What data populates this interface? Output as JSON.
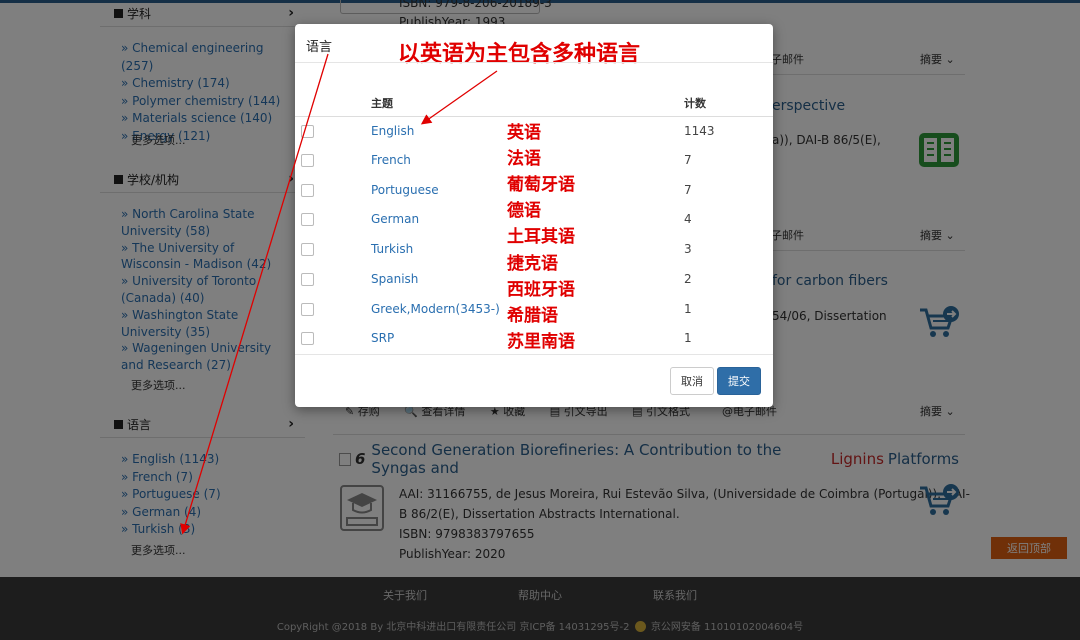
{
  "sidebar": {
    "subject": {
      "title": "学科",
      "items": [
        {
          "label": "» Chemical engineering",
          "count": "(257)"
        },
        {
          "label": "» Chemistry",
          "count": "(174)"
        },
        {
          "label": "» Polymer chemistry",
          "count": "(144)"
        },
        {
          "label": "» Materials science",
          "count": "(140)"
        },
        {
          "label": "» Energy",
          "count": "(121)"
        }
      ],
      "more": "更多选项..."
    },
    "school": {
      "title": "学校/机构",
      "items": [
        {
          "label": "» North Carolina State University",
          "count": "(58)"
        },
        {
          "label": "» The University of Wisconsin - Madison",
          "count": "(42)"
        },
        {
          "label": "» University of Toronto (Canada)",
          "count": "(40)"
        },
        {
          "label": "» Washington State University",
          "count": "(35)"
        },
        {
          "label": "» Wageningen University and Research",
          "count": "(27)"
        }
      ],
      "more": "更多选项..."
    },
    "language": {
      "title": "语言",
      "items": [
        {
          "label": "» English",
          "count": "(1143)"
        },
        {
          "label": "» French",
          "count": "(7)"
        },
        {
          "label": "» Portuguese",
          "count": "(7)"
        },
        {
          "label": "» German",
          "count": "(4)"
        },
        {
          "label": "» Turkish",
          "count": "(3)"
        }
      ],
      "more": "更多选项..."
    }
  },
  "results": {
    "top_isbn": "ISBN: 979-8-206-20189-3",
    "top_year": "PublishYear: 1993",
    "email_label": "子邮件",
    "abstract_label": "摘要 ⌄",
    "peek_title_1": "erspective",
    "peek_text_1": "a)), DAI-B 86/5(E),",
    "peek_title_2": "for carbon fibers",
    "peek_text_2": "54/06, Dissertation",
    "tools": [
      "✎ 存购",
      "🔍 查看详情",
      "★ 收藏",
      "▤ 引文导出",
      "▤ 引文格式"
    ],
    "email_full": "@电子邮件",
    "item6": {
      "number": "6",
      "title_pre": "Second Generation Biorefineries: A Contribution to the Syngas and",
      "title_hl": "Lignins",
      "title_post": "Platforms",
      "meta_1": "AAI: 31166755, de Jesus Moreira, Rui Estevão Silva, (Universidade de Coimbra (Portugal)), DAI-",
      "meta_2": "B 86/2(E), Dissertation Abstracts International.",
      "isbn": "ISBN: 9798383797655",
      "year": "PublishYear: 2020"
    },
    "back_to_top": "返回顶部"
  },
  "footer": {
    "links": [
      "关于我们",
      "帮助中心",
      "联系我们"
    ],
    "copyright_pre": "CopyRight @2018 By 北京中科进出口有限责任公司 京ICP备 14031295号-2",
    "copyright_post": "京公网安备 11010102004604号"
  },
  "modal": {
    "title": "语言",
    "headline": "以英语为主包含多种语言",
    "col_subject": "主题",
    "col_count": "计数",
    "rows": [
      {
        "lang": "English",
        "count": "1143",
        "cn": "英语"
      },
      {
        "lang": "French",
        "count": "7",
        "cn": "法语"
      },
      {
        "lang": "Portuguese",
        "count": "7",
        "cn": "葡萄牙语"
      },
      {
        "lang": "German",
        "count": "4",
        "cn": "德语"
      },
      {
        "lang": "Turkish",
        "count": "3",
        "cn": "土耳其语"
      },
      {
        "lang": "Spanish",
        "count": "2",
        "cn": "捷克语"
      },
      {
        "lang": "Greek,Modern(3453-)",
        "count": "1",
        "cn": "西班牙语"
      },
      {
        "lang": "SRP",
        "count": "1",
        "cn": "希腊语"
      }
    ],
    "extra_cn": "苏里南语",
    "cancel_label": "取消",
    "submit_label": "提交"
  },
  "colors": {
    "annotation_red": "#e00000",
    "link_blue": "#2a6fb0",
    "submit_blue": "#2f6ea8",
    "back_to_top_orange": "#e06010"
  }
}
